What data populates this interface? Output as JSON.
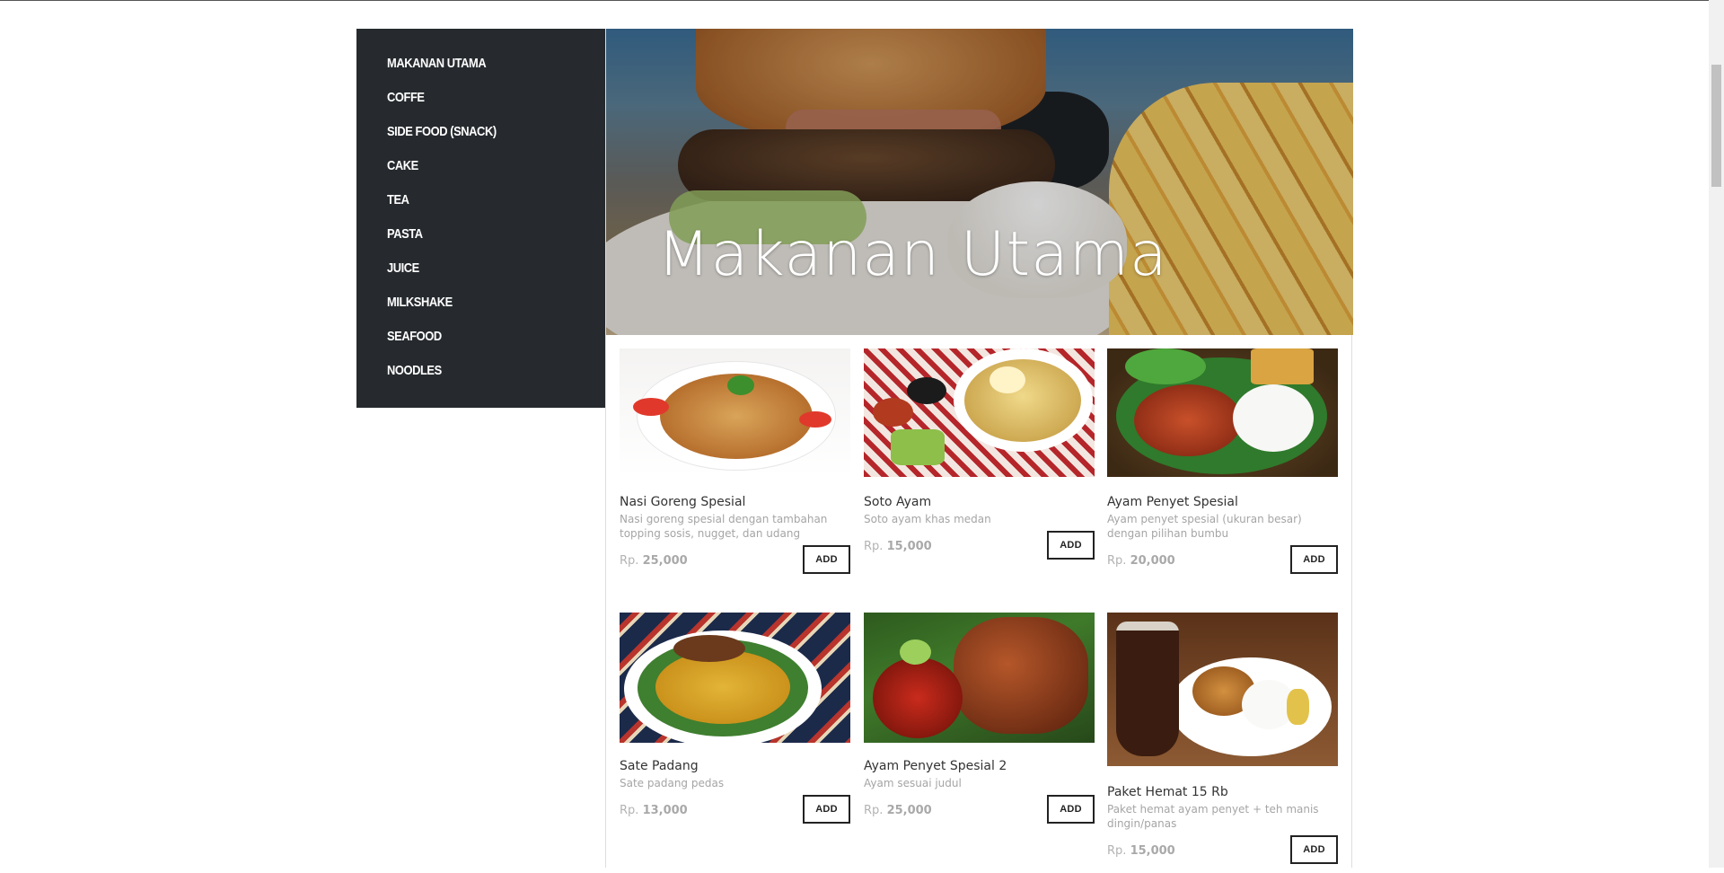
{
  "sidebar": {
    "items": [
      {
        "label": "MAKANAN UTAMA"
      },
      {
        "label": "COFFE"
      },
      {
        "label": "SIDE FOOD (SNACK)"
      },
      {
        "label": "CAKE"
      },
      {
        "label": "TEA"
      },
      {
        "label": "PASTA"
      },
      {
        "label": "JUICE"
      },
      {
        "label": "MILKSHAKE"
      },
      {
        "label": "SEAFOOD"
      },
      {
        "label": "NOODLES"
      }
    ]
  },
  "hero": {
    "title": "Makanan Utama"
  },
  "products": [
    {
      "name": "Nasi Goreng Spesial",
      "description": "Nasi goreng spesial dengan tambahan topping sosis, nugget, dan udang",
      "currency": "Rp.",
      "price": "25,000",
      "button": "ADD"
    },
    {
      "name": "Soto Ayam",
      "description": "Soto ayam khas medan",
      "currency": "Rp.",
      "price": "15,000",
      "button": "ADD"
    },
    {
      "name": "Ayam Penyet Spesial",
      "description": "Ayam penyet spesial (ukuran besar) dengan pilihan bumbu",
      "currency": "Rp.",
      "price": "20,000",
      "button": "ADD"
    },
    {
      "name": "Sate Padang",
      "description": "Sate padang pedas",
      "currency": "Rp.",
      "price": "13,000",
      "button": "ADD"
    },
    {
      "name": "Ayam Penyet Spesial 2",
      "description": "Ayam sesuai judul",
      "currency": "Rp.",
      "price": "25,000",
      "button": "ADD"
    },
    {
      "name": "Paket Hemat 15 Rb",
      "description": "Paket hemat ayam penyet + teh manis dingin/panas",
      "currency": "Rp.",
      "price": "15,000",
      "button": "ADD"
    }
  ],
  "colors": {
    "sidebar_bg": "#262a2e",
    "text_muted": "#a5a5a5",
    "button_border": "#222222"
  }
}
